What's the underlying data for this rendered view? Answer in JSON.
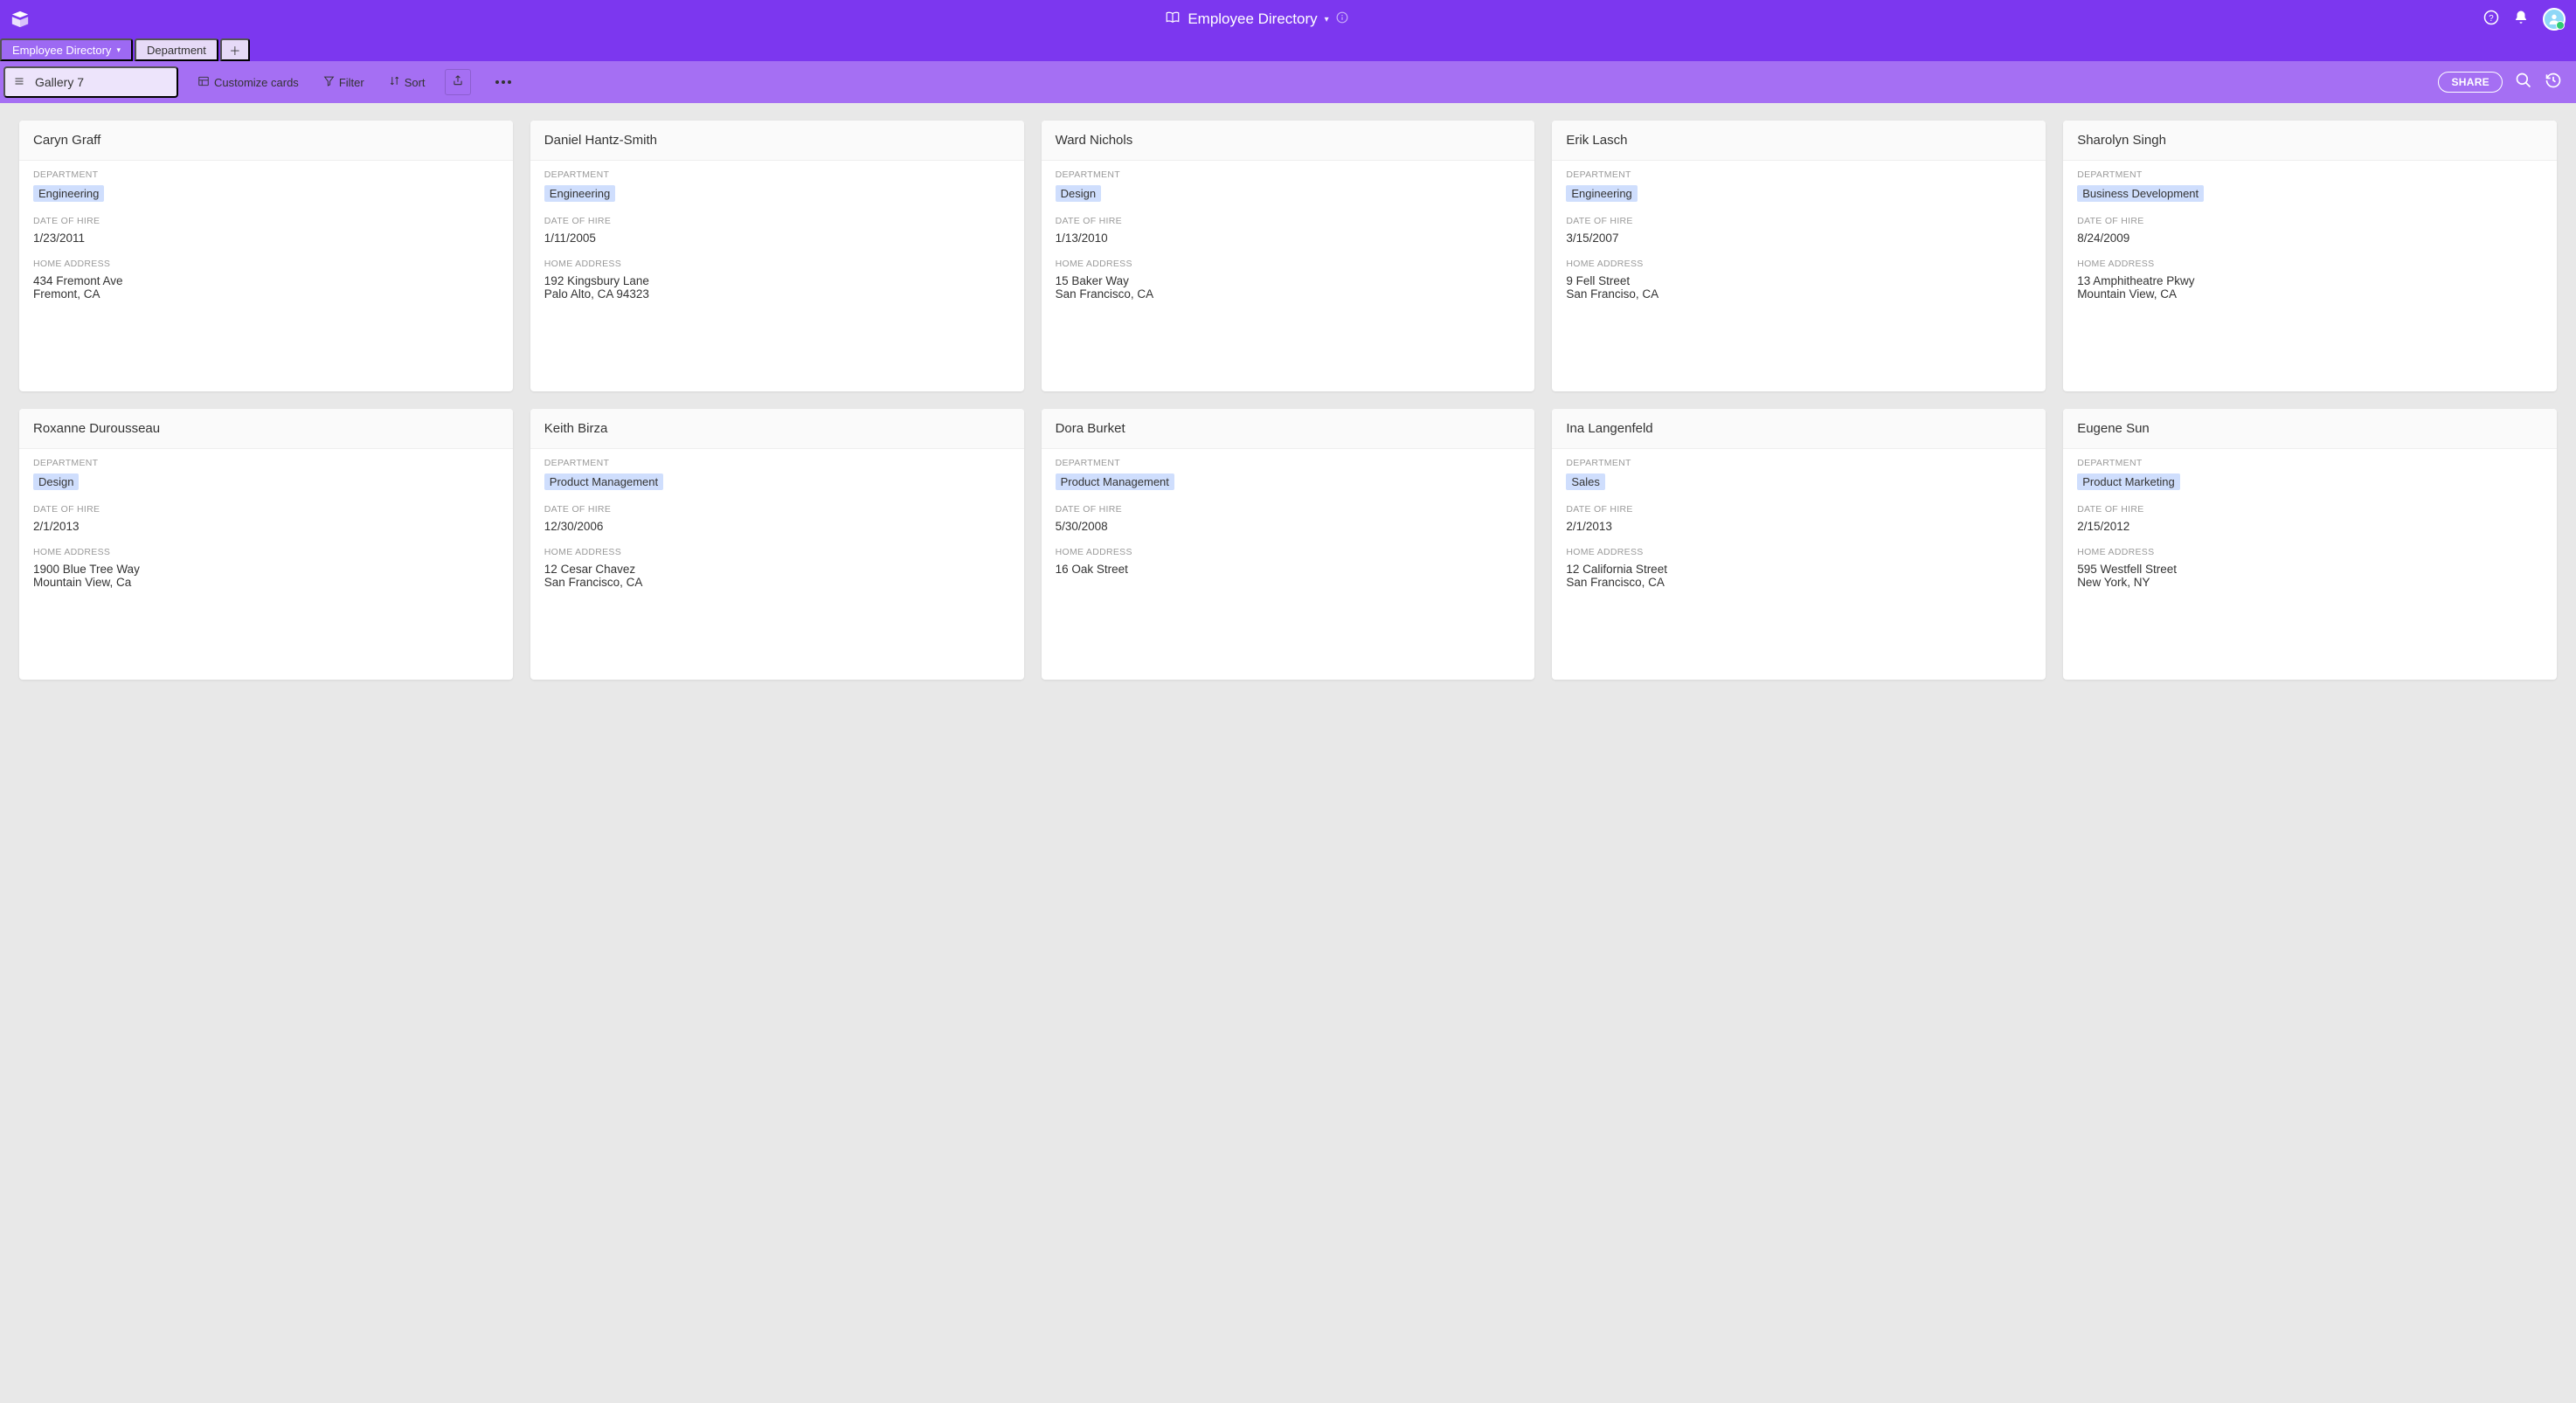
{
  "brand_color": "#7c37ef",
  "header": {
    "base_name": "Employee Directory"
  },
  "tabs": [
    {
      "label": "Employee Directory",
      "active": true
    },
    {
      "label": "Department",
      "active": false
    }
  ],
  "viewbar": {
    "view_name": "Gallery 7",
    "customize_label": "Customize cards",
    "filter_label": "Filter",
    "sort_label": "Sort",
    "share_label": "SHARE"
  },
  "field_labels": {
    "department": "DEPARTMENT",
    "date_of_hire": "DATE OF HIRE",
    "home_address": "HOME ADDRESS"
  },
  "cards": [
    {
      "name": "Caryn Graff",
      "department": "Engineering",
      "date_of_hire": "1/23/2011",
      "address_line1": "434 Fremont Ave",
      "address_line2": "Fremont, CA"
    },
    {
      "name": "Daniel Hantz-Smith",
      "department": "Engineering",
      "date_of_hire": "1/11/2005",
      "address_line1": "192 Kingsbury Lane",
      "address_line2": "Palo Alto, CA 94323"
    },
    {
      "name": "Ward Nichols",
      "department": "Design",
      "date_of_hire": "1/13/2010",
      "address_line1": "15 Baker Way",
      "address_line2": "San Francisco, CA"
    },
    {
      "name": "Erik Lasch",
      "department": "Engineering",
      "date_of_hire": "3/15/2007",
      "address_line1": "9 Fell Street",
      "address_line2": "San Franciso, CA"
    },
    {
      "name": "Sharolyn Singh",
      "department": "Business Development",
      "date_of_hire": "8/24/2009",
      "address_line1": "13 Amphitheatre Pkwy",
      "address_line2": "Mountain View, CA"
    },
    {
      "name": "Roxanne Durousseau",
      "department": "Design",
      "date_of_hire": "2/1/2013",
      "address_line1": "1900 Blue Tree Way",
      "address_line2": "Mountain View, Ca"
    },
    {
      "name": "Keith Birza",
      "department": "Product Management",
      "date_of_hire": "12/30/2006",
      "address_line1": "12 Cesar Chavez",
      "address_line2": "San Francisco, CA"
    },
    {
      "name": "Dora Burket",
      "department": "Product Management",
      "date_of_hire": "5/30/2008",
      "address_line1": "16 Oak Street",
      "address_line2": ""
    },
    {
      "name": "Ina Langenfeld",
      "department": "Sales",
      "date_of_hire": "2/1/2013",
      "address_line1": "12 California Street",
      "address_line2": "San Francisco, CA"
    },
    {
      "name": "Eugene Sun",
      "department": "Product Marketing",
      "date_of_hire": "2/15/2012",
      "address_line1": "595 Westfell Street",
      "address_line2": "New York, NY"
    }
  ]
}
